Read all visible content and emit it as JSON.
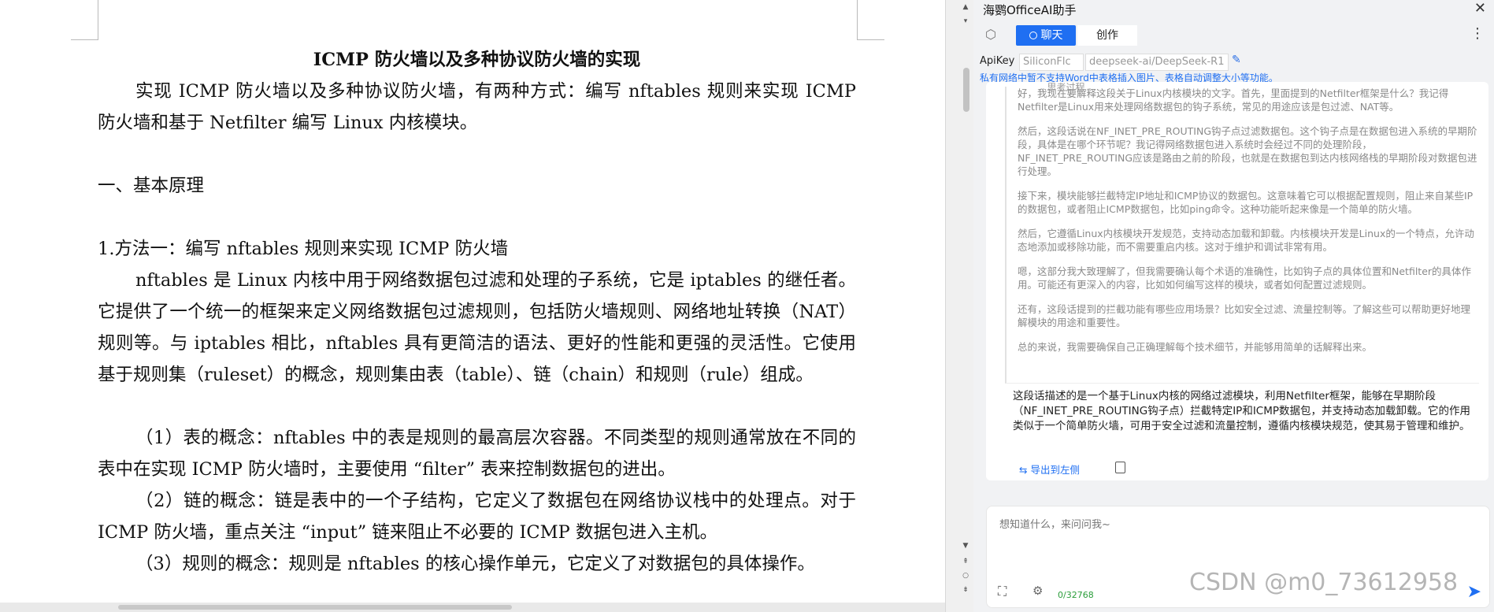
{
  "document": {
    "title": "ICMP 防火墙以及多种协议防火墙的实现",
    "paragraphs": [
      "实现 ICMP 防火墙以及多种协议防火墙，有两种方式：编写 nftables 规则来实现 ICMP 防火墙和基于 Netfilter 编写 Linux 内核模块。",
      "一、基本原理",
      "1.方法一：编写 nftables 规则来实现 ICMP 防火墙",
      "nftables 是 Linux 内核中用于网络数据包过滤和处理的子系统，它是 iptables 的继任者。它提供了一个统一的框架来定义网络数据包过滤规则，包括防火墙规则、网络地址转换（NAT）规则等。与 iptables 相比，nftables 具有更简洁的语法、更好的性能和更强的灵活性。它使用基于规则集（ruleset）的概念，规则集由表（table）、链（chain）和规则（rule）组成。",
      "（1）表的概念：nftables 中的表是规则的最高层次容器。不同类型的规则通常放在不同的表中在实现 ICMP 防火墙时，主要使用 “filter” 表来控制数据包的进出。",
      "（2）链的概念：链是表中的一个子结构，它定义了数据包在网络协议栈中的处理点。对于 ICMP 防火墙，重点关注 “input” 链来阻止不必要的 ICMP 数据包进入主机。",
      "（3）规则的概念：规则是 nftables 的核心操作单元，它定义了对数据包的具体操作。"
    ]
  },
  "panel": {
    "title": "海鹦OfficeAI助手",
    "close_icon": "close-icon",
    "tabs": {
      "chat": "聊天",
      "create": "创作"
    },
    "api_label": "ApiKey",
    "api_provider": "SiliconFlc",
    "model": "deepseek-ai/DeepSeek-R1",
    "notice": "私有网络中暂不支持Word中表格插入图片、表格自动调整大小等功能。",
    "thinking_header": "...思考过程",
    "thinking": [
      "好，我现在要解释这段关于Linux内核模块的文字。首先，里面提到的Netfilter框架是什么？我记得Netfilter是Linux用来处理网络数据包的钩子系统，常见的用途应该是包过滤、NAT等。",
      "然后，这段话说在NF_INET_PRE_ROUTING钩子点过滤数据包。这个钩子点是在数据包进入系统的早期阶段，具体是在哪个环节呢？我记得网络数据包进入系统时会经过不同的处理阶段，NF_INET_PRE_ROUTING应该是路由之前的阶段，也就是在数据包到达内核网络栈的早期阶段对数据包进行处理。",
      "接下来，模块能够拦截特定IP地址和ICMP协议的数据包。这意味着它可以根据配置规则，阻止来自某些IP的数据包，或者阻止ICMP数据包，比如ping命令。这种功能听起来像是一个简单的防火墙。",
      "然后，它遵循Linux内核模块开发规范，支持动态加载和卸载。内核模块开发是Linux的一个特点，允许动态地添加或移除功能，而不需要重启内核。这对于维护和调试非常有用。",
      "嗯，这部分我大致理解了，但我需要确认每个术语的准确性，比如钩子点的具体位置和Netfilter的具体作用。可能还有更深入的内容，比如如何编写这样的模块，或者如何配置过滤规则。",
      "还有，这段话提到的拦截功能有哪些应用场景？比如安全过滤、流量控制等。了解这些可以帮助更好地理解模块的用途和重要性。",
      "总的来说，我需要确保自己正确理解每个技术细节，并能够用简单的话解释出来。"
    ],
    "answer": "这段话描述的是一个基于Linux内核的网络过滤模块，利用Netfilter框架，能够在早期阶段（NF_INET_PRE_ROUTING钩子点）拦截特定IP和ICMP数据包，并支持动态加载卸载。它的作用类似于一个简单防火墙，可用于安全过滤和流量控制，遵循内核模块规范，使其易于管理和维护。",
    "export_label": "导出到左侧",
    "input_placeholder": "想知道什么，来问问我~",
    "counter": "0/32768"
  },
  "watermark": "CSDN @m0_73612958",
  "colors": {
    "accent": "#1f6ff2",
    "counter": "#2a9d3a"
  }
}
